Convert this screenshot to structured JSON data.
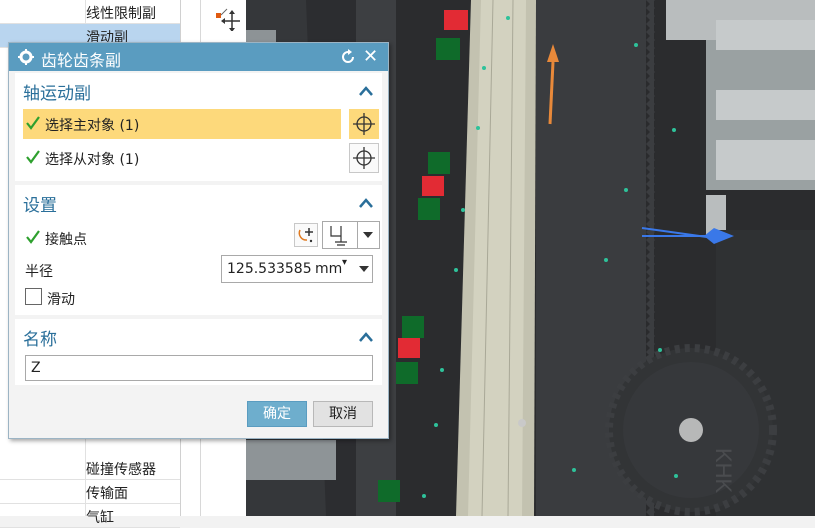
{
  "background_list": {
    "top_items": [
      "线性限制副",
      "滑动副"
    ],
    "bottom_items": [
      "碰撞传感器",
      "传输面",
      "气缸"
    ]
  },
  "dialog": {
    "title": "齿轮齿条副",
    "sections": {
      "axis_motion": {
        "header": "轴运动副",
        "select_master": "选择主对象 (1)",
        "select_slave": "选择从对象 (1)"
      },
      "settings": {
        "header": "设置",
        "contact_point": "接触点",
        "radius_label": "半径",
        "radius_value": "125.533585",
        "radius_unit": "mm",
        "sliding_label": "滑动"
      },
      "name": {
        "header": "名称",
        "value": "Z"
      }
    },
    "buttons": {
      "ok": "确定",
      "cancel": "取消"
    }
  },
  "colors": {
    "title_bar": "#5a9cc0",
    "section_header": "#2a6f9a",
    "active_selection": "#fdd97b",
    "check": "#2ea02e",
    "ok_button": "#6eaecd"
  },
  "icons": [
    "gear-icon",
    "reset-icon",
    "close-icon",
    "collapse-icon",
    "check-icon",
    "crosshair-icon",
    "point-icon",
    "dropdown-icon",
    "move-handle-icon"
  ]
}
